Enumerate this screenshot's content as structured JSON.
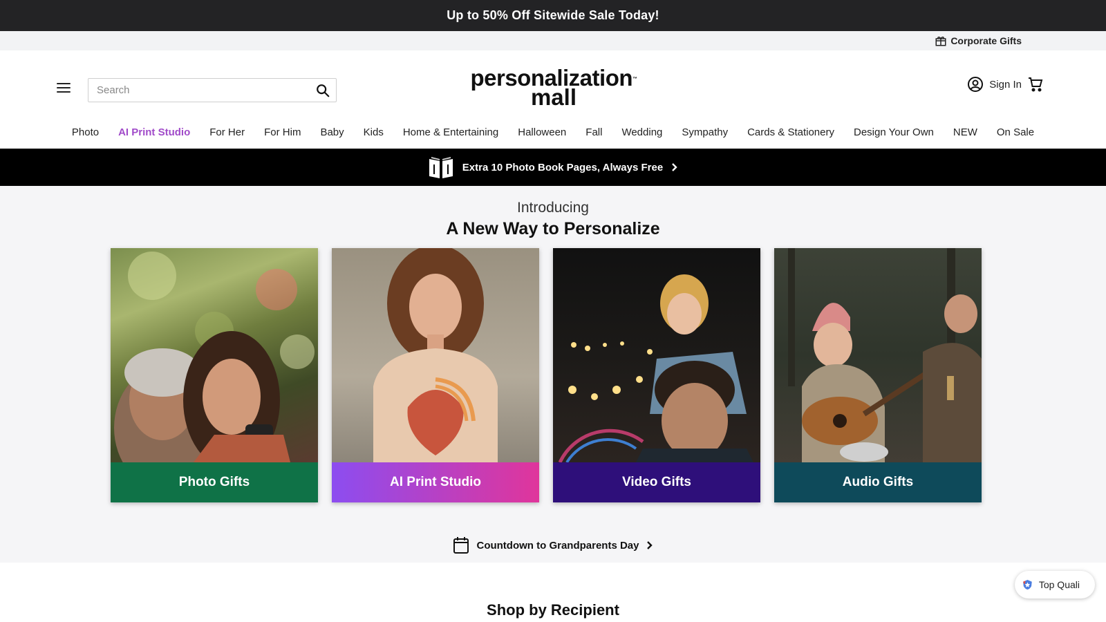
{
  "promo": {
    "text": "Up to 50% Off Sitewide Sale Today!"
  },
  "utility": {
    "corporate_gifts": "Corporate Gifts"
  },
  "header": {
    "search_placeholder": "Search",
    "logo_line1": "personalization",
    "logo_line2": "mall",
    "logo_tm": "™",
    "sign_in": "Sign In"
  },
  "nav": {
    "items": [
      "Photo",
      "AI Print Studio",
      "For Her",
      "For Him",
      "Baby",
      "Kids",
      "Home & Entertaining",
      "Halloween",
      "Fall",
      "Wedding",
      "Sympathy",
      "Cards & Stationery",
      "Design Your Own",
      "NEW",
      "On Sale"
    ],
    "accent_color": "#a04ac9"
  },
  "book_banner": {
    "text": "Extra 10 Photo Book Pages, Always Free"
  },
  "hero": {
    "intro_small": "Introducing",
    "intro_big": "A New Way to Personalize",
    "cards": [
      {
        "label": "Photo Gifts",
        "color": "#0f7247"
      },
      {
        "label": "AI Print Studio",
        "color": "linear-gradient(90deg,#8c4df0,#e0359b)"
      },
      {
        "label": "Video Gifts",
        "color": "#2e0f7a"
      },
      {
        "label": "Audio Gifts",
        "color": "#0e4a5a"
      }
    ],
    "countdown": "Countdown to Grandparents Day"
  },
  "shop_by_recipient": {
    "title": "Shop by Recipient"
  },
  "badge": {
    "text": "Top Quali"
  }
}
